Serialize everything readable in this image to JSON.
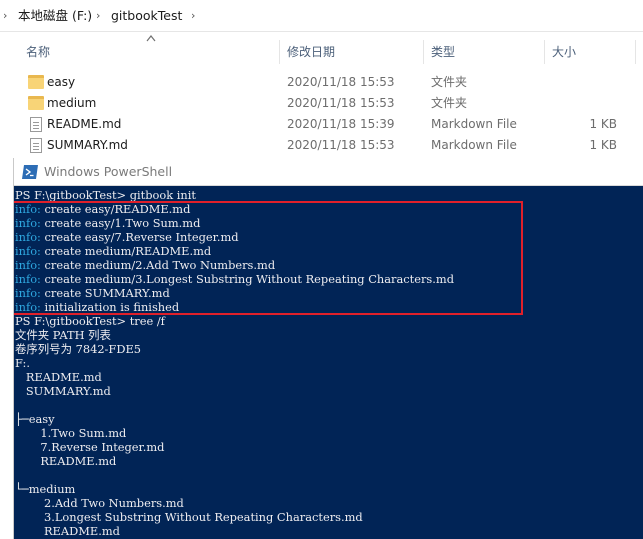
{
  "explorer": {
    "breadcrumb": [
      {
        "label": "本地磁盘 (F:)"
      },
      {
        "label": "gitbookTest"
      }
    ],
    "columns": {
      "name": "名称",
      "date": "修改日期",
      "type": "类型",
      "size": "大小"
    },
    "files": [
      {
        "name": "easy",
        "date": "2020/11/18 15:53",
        "type": "文件夹",
        "size": "",
        "icon": "folder-icon"
      },
      {
        "name": "medium",
        "date": "2020/11/18 15:53",
        "type": "文件夹",
        "size": "",
        "icon": "folder-icon"
      },
      {
        "name": "README.md",
        "date": "2020/11/18 15:39",
        "type": "Markdown File",
        "size": "1 KB",
        "icon": "markdown-file-icon"
      },
      {
        "name": "SUMMARY.md",
        "date": "2020/11/18 15:53",
        "type": "Markdown File",
        "size": "1 KB",
        "icon": "markdown-file-icon"
      }
    ]
  },
  "powershell": {
    "title": "Windows PowerShell",
    "colors": {
      "background": "#012456",
      "text": "#eeedf0",
      "info": "#2fa8e0",
      "highlight": "#e0202a"
    },
    "lines": [
      {
        "text": "PS F:\\gitbookTest> gitbook init"
      },
      {
        "prefix": "info:",
        "text": " create easy/README.md"
      },
      {
        "prefix": "info:",
        "text": " create easy/1.Two Sum.md"
      },
      {
        "prefix": "info:",
        "text": " create easy/7.Reverse Integer.md"
      },
      {
        "prefix": "info:",
        "text": " create medium/README.md"
      },
      {
        "prefix": "info:",
        "text": " create medium/2.Add Two Numbers.md"
      },
      {
        "prefix": "info:",
        "text": " create medium/3.Longest Substring Without Repeating Characters.md"
      },
      {
        "prefix": "info:",
        "text": " create SUMMARY.md"
      },
      {
        "prefix": "info:",
        "text": " initialization is finished"
      },
      {
        "text": "PS F:\\gitbookTest> tree /f"
      },
      {
        "text": "文件夹 PATH 列表"
      },
      {
        "text": "卷序列号为 7842-FDE5"
      },
      {
        "text": "F:."
      },
      {
        "text": "   README.md"
      },
      {
        "text": "   SUMMARY.md"
      },
      {
        "text": ""
      },
      {
        "text": "├─easy"
      },
      {
        "text": "       1.Two Sum.md"
      },
      {
        "text": "       7.Reverse Integer.md"
      },
      {
        "text": "       README.md"
      },
      {
        "text": ""
      },
      {
        "text": "└─medium"
      },
      {
        "text": "        2.Add Two Numbers.md"
      },
      {
        "text": "        3.Longest Substring Without Repeating Characters.md"
      },
      {
        "text": "        README.md"
      }
    ]
  }
}
